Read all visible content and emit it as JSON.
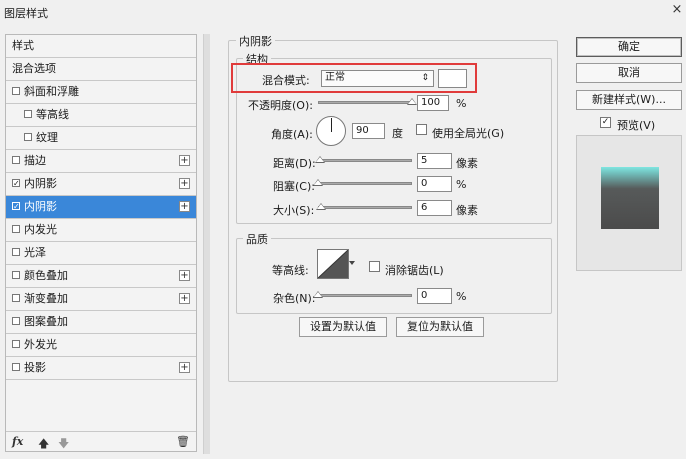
{
  "window": {
    "title": "图层样式",
    "close": "×"
  },
  "sidebar": {
    "header": "样式",
    "items": [
      {
        "label": "混合选项"
      },
      {
        "label": "斜面和浮雕",
        "check": ""
      },
      {
        "label": "等高线",
        "check": ""
      },
      {
        "label": "纹理",
        "check": ""
      },
      {
        "label": "描边",
        "check": "",
        "plus": "+"
      },
      {
        "label": "内阴影",
        "check": "✓",
        "plus": "+"
      },
      {
        "label": "内阴影",
        "check": "✓",
        "plus": "+"
      },
      {
        "label": "内发光",
        "check": ""
      },
      {
        "label": "光泽",
        "check": ""
      },
      {
        "label": "颜色叠加",
        "check": "",
        "plus": "+"
      },
      {
        "label": "渐变叠加",
        "check": "",
        "plus": "+"
      },
      {
        "label": "图案叠加",
        "check": ""
      },
      {
        "label": "外发光",
        "check": ""
      },
      {
        "label": "投影",
        "check": "",
        "plus": "+"
      }
    ],
    "footer": {
      "fx": "fx",
      "up": "🡅",
      "down": "🡇",
      "trash": "🗑"
    }
  },
  "inner_shadow": {
    "title": "内阴影",
    "structure": {
      "title": "结构",
      "blend_label": "混合模式:",
      "blend_value": "正常",
      "opacity_label": "不透明度(O):",
      "opacity_value": "100",
      "opacity_unit": "%",
      "opacity_level": 1.0,
      "angle_label": "角度(A):",
      "angle_value": "90",
      "angle_unit": "度",
      "global_light_label": "使用全局光(G)",
      "distance_label": "距离(D):",
      "distance_value": "5",
      "distance_unit": "像素",
      "choke_label": "阻塞(C):",
      "choke_value": "0",
      "choke_unit": "%",
      "size_label": "大小(S):",
      "size_value": "6",
      "size_unit": "像素"
    },
    "quality": {
      "title": "品质",
      "contour_label": "等高线:",
      "antialias_label": "消除锯齿(L)",
      "noise_label": "杂色(N):",
      "noise_value": "0",
      "noise_unit": "%"
    },
    "make_default": "设置为默认值",
    "reset_default": "复位为默认值"
  },
  "actions": {
    "ok": "确定",
    "cancel": "取消",
    "new_style": "新建样式(W)...",
    "preview_label": "预览(V)",
    "preview_check": "✓"
  },
  "colors": {
    "selection": "#3a87d9",
    "highlight_box": "#e03b3b",
    "preview_top": "#7fe6e1",
    "preview_bottom": "#4b4b4b"
  }
}
